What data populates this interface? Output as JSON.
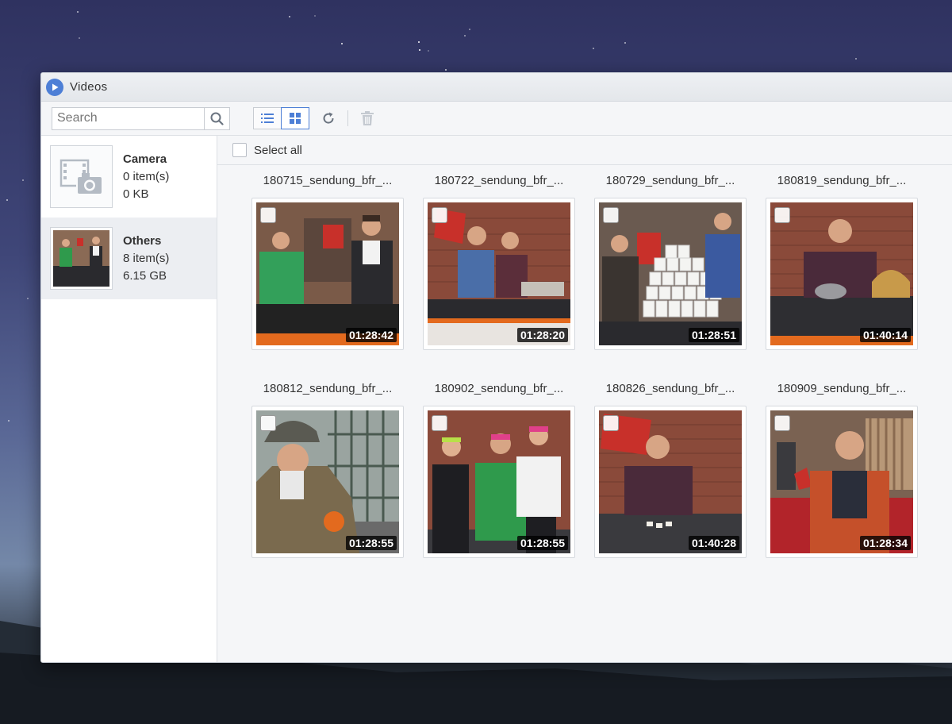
{
  "window": {
    "title": "Videos"
  },
  "toolbar": {
    "search_placeholder": "Search",
    "view_list": "list-view-icon",
    "view_grid": "grid-view-icon",
    "refresh": "refresh-icon",
    "delete": "trash-icon"
  },
  "sidebar": {
    "albums": [
      {
        "name": "Camera",
        "count": "0 item(s)",
        "size": "0 KB"
      },
      {
        "name": "Others",
        "count": "8 item(s)",
        "size": "6.15 GB"
      }
    ]
  },
  "main": {
    "select_all": "Select all",
    "videos": [
      {
        "name": "180715_sendung_bfr_...",
        "duration": "01:28:42"
      },
      {
        "name": "180722_sendung_bfr_...",
        "duration": "01:28:20"
      },
      {
        "name": "180729_sendung_bfr_...",
        "duration": "01:28:51"
      },
      {
        "name": "180819_sendung_bfr_...",
        "duration": "01:40:14"
      },
      {
        "name": "180812_sendung_bfr_...",
        "duration": "01:28:55"
      },
      {
        "name": "180902_sendung_bfr_...",
        "duration": "01:28:55"
      },
      {
        "name": "180826_sendung_bfr_...",
        "duration": "01:40:28"
      },
      {
        "name": "180909_sendung_bfr_...",
        "duration": "01:28:34"
      }
    ]
  },
  "colors": {
    "accent": "#4d7fd6",
    "brick": "#8a4a3a",
    "red_logo": "#c8302a"
  }
}
